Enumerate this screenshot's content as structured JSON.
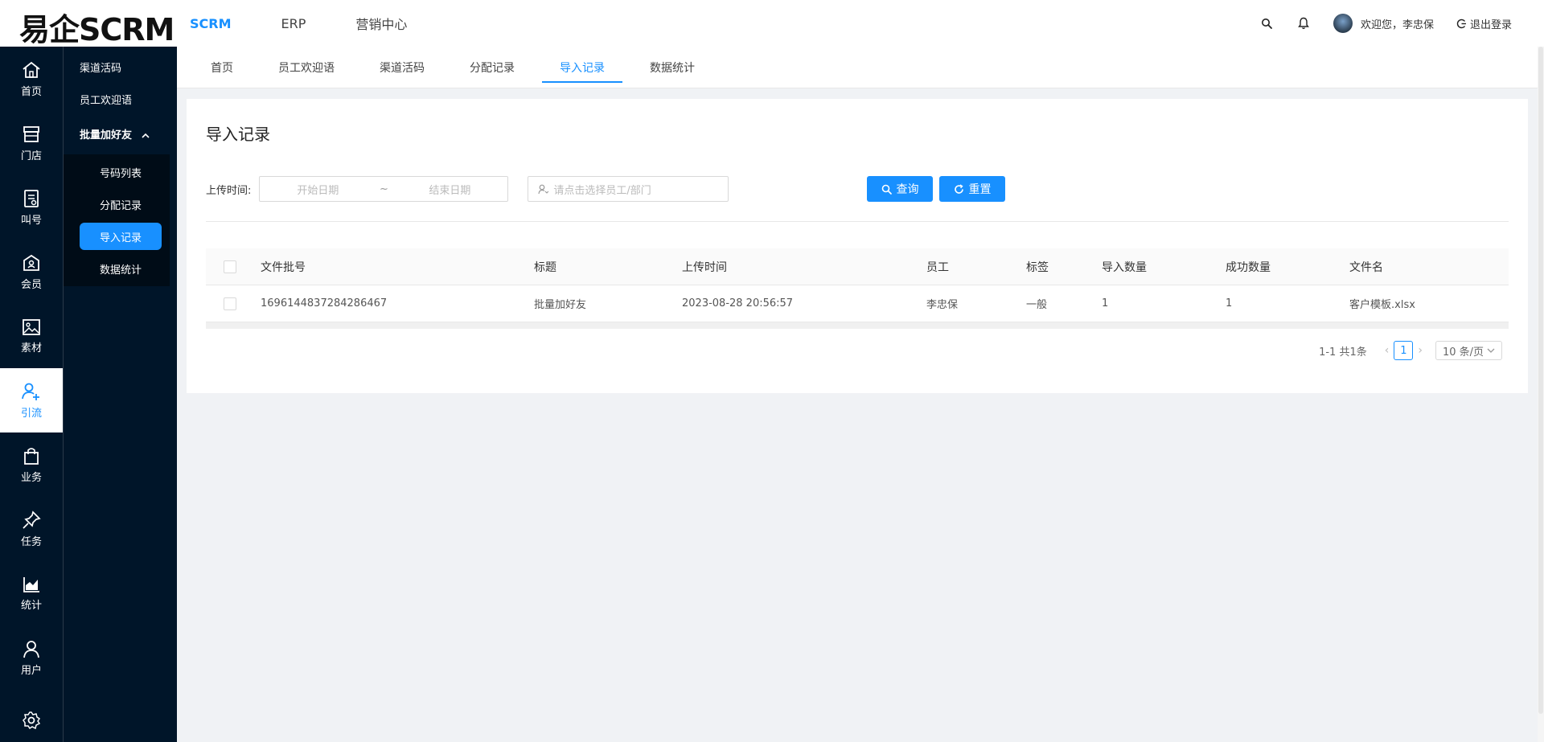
{
  "header": {
    "logo": "易企SCRM",
    "nav": [
      {
        "label": "SCRM",
        "active": true
      },
      {
        "label": "ERP",
        "active": false
      },
      {
        "label": "营销中心",
        "active": false
      }
    ],
    "welcome": "欢迎您，李忠保",
    "logout": "退出登录"
  },
  "iconbar": [
    {
      "label": "首页",
      "icon": "home-icon",
      "active": false
    },
    {
      "label": "门店",
      "icon": "store-icon",
      "active": false
    },
    {
      "label": "叫号",
      "icon": "queue-icon",
      "active": false
    },
    {
      "label": "会员",
      "icon": "member-icon",
      "active": false
    },
    {
      "label": "素材",
      "icon": "image-icon",
      "active": false
    },
    {
      "label": "引流",
      "icon": "user-add-icon",
      "active": true
    },
    {
      "label": "业务",
      "icon": "bag-icon",
      "active": false
    },
    {
      "label": "任务",
      "icon": "pin-icon",
      "active": false
    },
    {
      "label": "统计",
      "icon": "chart-icon",
      "active": false
    },
    {
      "label": "用户",
      "icon": "user-icon",
      "active": false
    },
    {
      "label": "",
      "icon": "gear-icon",
      "active": false
    }
  ],
  "submenu": {
    "items": [
      "渠道活码",
      "员工欢迎语"
    ],
    "group": "批量加好友",
    "children": [
      {
        "label": "号码列表",
        "active": false
      },
      {
        "label": "分配记录",
        "active": false
      },
      {
        "label": "导入记录",
        "active": true
      },
      {
        "label": "数据统计",
        "active": false
      }
    ]
  },
  "tabs": [
    {
      "label": "首页",
      "active": false
    },
    {
      "label": "员工欢迎语",
      "active": false
    },
    {
      "label": "渠道活码",
      "active": false
    },
    {
      "label": "分配记录",
      "active": false
    },
    {
      "label": "导入记录",
      "active": true
    },
    {
      "label": "数据统计",
      "active": false
    }
  ],
  "page": {
    "title": "导入记录",
    "filter_label": "上传时间:",
    "date_start_placeholder": "开始日期",
    "date_sep": "~",
    "date_end_placeholder": "结束日期",
    "employee_placeholder": "请点击选择员工/部门",
    "query_btn": "查询",
    "reset_btn": "重置"
  },
  "table": {
    "columns": [
      "文件批号",
      "标题",
      "上传时间",
      "员工",
      "标签",
      "导入数量",
      "成功数量",
      "文件名"
    ],
    "rows": [
      [
        "1696144837284286467",
        "批量加好友",
        "2023-08-28 20:56:57",
        "李忠保",
        "一般",
        "1",
        "1",
        "客户模板.xlsx"
      ]
    ]
  },
  "pagination": {
    "total": "1-1 共1条",
    "current": "1",
    "page_size": "10 条/页"
  },
  "colors": {
    "primary": "#1890ff",
    "sidebar": "#001529"
  }
}
